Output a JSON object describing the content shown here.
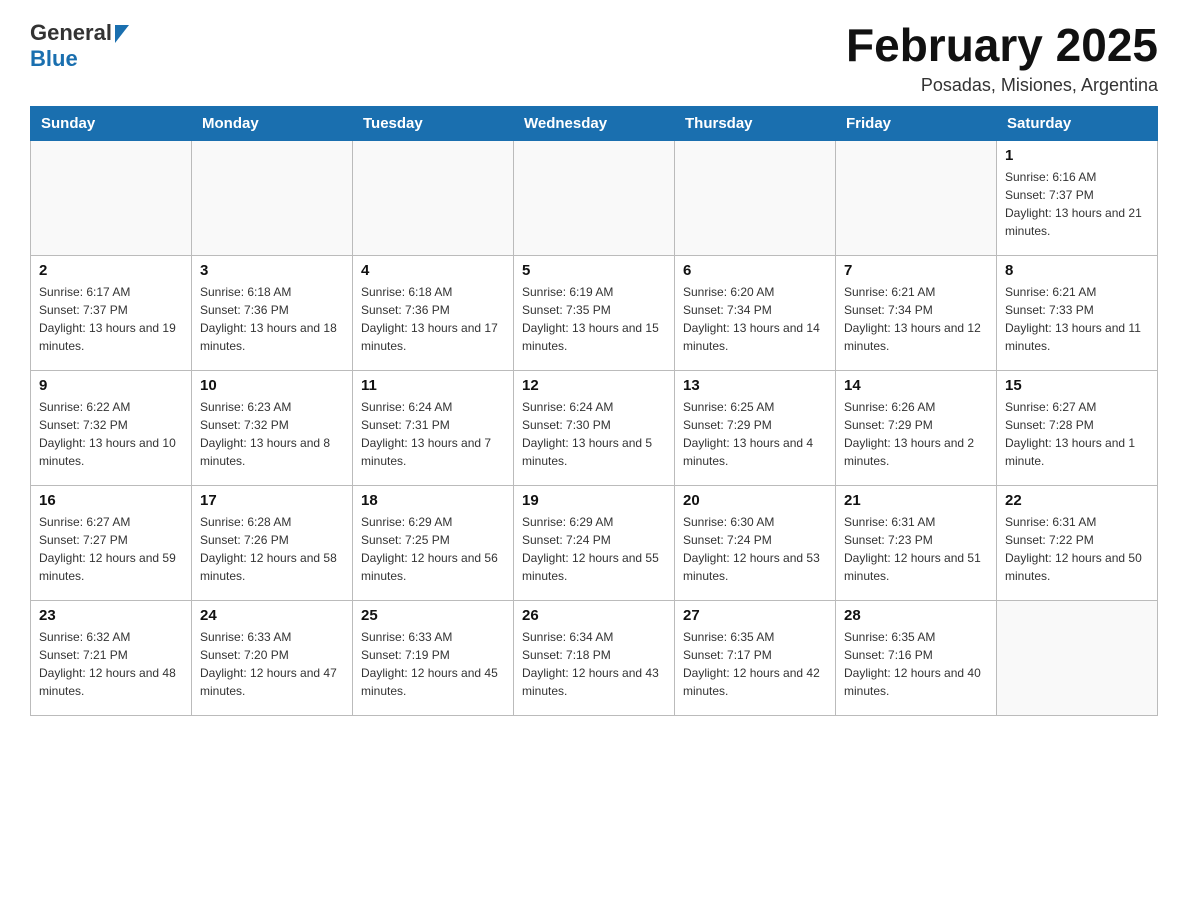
{
  "header": {
    "logo": {
      "general": "General",
      "blue": "Blue"
    },
    "title": "February 2025",
    "subtitle": "Posadas, Misiones, Argentina"
  },
  "calendar": {
    "headers": [
      "Sunday",
      "Monday",
      "Tuesday",
      "Wednesday",
      "Thursday",
      "Friday",
      "Saturday"
    ],
    "rows": [
      [
        {
          "day": "",
          "info": ""
        },
        {
          "day": "",
          "info": ""
        },
        {
          "day": "",
          "info": ""
        },
        {
          "day": "",
          "info": ""
        },
        {
          "day": "",
          "info": ""
        },
        {
          "day": "",
          "info": ""
        },
        {
          "day": "1",
          "info": "Sunrise: 6:16 AM\nSunset: 7:37 PM\nDaylight: 13 hours and 21 minutes."
        }
      ],
      [
        {
          "day": "2",
          "info": "Sunrise: 6:17 AM\nSunset: 7:37 PM\nDaylight: 13 hours and 19 minutes."
        },
        {
          "day": "3",
          "info": "Sunrise: 6:18 AM\nSunset: 7:36 PM\nDaylight: 13 hours and 18 minutes."
        },
        {
          "day": "4",
          "info": "Sunrise: 6:18 AM\nSunset: 7:36 PM\nDaylight: 13 hours and 17 minutes."
        },
        {
          "day": "5",
          "info": "Sunrise: 6:19 AM\nSunset: 7:35 PM\nDaylight: 13 hours and 15 minutes."
        },
        {
          "day": "6",
          "info": "Sunrise: 6:20 AM\nSunset: 7:34 PM\nDaylight: 13 hours and 14 minutes."
        },
        {
          "day": "7",
          "info": "Sunrise: 6:21 AM\nSunset: 7:34 PM\nDaylight: 13 hours and 12 minutes."
        },
        {
          "day": "8",
          "info": "Sunrise: 6:21 AM\nSunset: 7:33 PM\nDaylight: 13 hours and 11 minutes."
        }
      ],
      [
        {
          "day": "9",
          "info": "Sunrise: 6:22 AM\nSunset: 7:32 PM\nDaylight: 13 hours and 10 minutes."
        },
        {
          "day": "10",
          "info": "Sunrise: 6:23 AM\nSunset: 7:32 PM\nDaylight: 13 hours and 8 minutes."
        },
        {
          "day": "11",
          "info": "Sunrise: 6:24 AM\nSunset: 7:31 PM\nDaylight: 13 hours and 7 minutes."
        },
        {
          "day": "12",
          "info": "Sunrise: 6:24 AM\nSunset: 7:30 PM\nDaylight: 13 hours and 5 minutes."
        },
        {
          "day": "13",
          "info": "Sunrise: 6:25 AM\nSunset: 7:29 PM\nDaylight: 13 hours and 4 minutes."
        },
        {
          "day": "14",
          "info": "Sunrise: 6:26 AM\nSunset: 7:29 PM\nDaylight: 13 hours and 2 minutes."
        },
        {
          "day": "15",
          "info": "Sunrise: 6:27 AM\nSunset: 7:28 PM\nDaylight: 13 hours and 1 minute."
        }
      ],
      [
        {
          "day": "16",
          "info": "Sunrise: 6:27 AM\nSunset: 7:27 PM\nDaylight: 12 hours and 59 minutes."
        },
        {
          "day": "17",
          "info": "Sunrise: 6:28 AM\nSunset: 7:26 PM\nDaylight: 12 hours and 58 minutes."
        },
        {
          "day": "18",
          "info": "Sunrise: 6:29 AM\nSunset: 7:25 PM\nDaylight: 12 hours and 56 minutes."
        },
        {
          "day": "19",
          "info": "Sunrise: 6:29 AM\nSunset: 7:24 PM\nDaylight: 12 hours and 55 minutes."
        },
        {
          "day": "20",
          "info": "Sunrise: 6:30 AM\nSunset: 7:24 PM\nDaylight: 12 hours and 53 minutes."
        },
        {
          "day": "21",
          "info": "Sunrise: 6:31 AM\nSunset: 7:23 PM\nDaylight: 12 hours and 51 minutes."
        },
        {
          "day": "22",
          "info": "Sunrise: 6:31 AM\nSunset: 7:22 PM\nDaylight: 12 hours and 50 minutes."
        }
      ],
      [
        {
          "day": "23",
          "info": "Sunrise: 6:32 AM\nSunset: 7:21 PM\nDaylight: 12 hours and 48 minutes."
        },
        {
          "day": "24",
          "info": "Sunrise: 6:33 AM\nSunset: 7:20 PM\nDaylight: 12 hours and 47 minutes."
        },
        {
          "day": "25",
          "info": "Sunrise: 6:33 AM\nSunset: 7:19 PM\nDaylight: 12 hours and 45 minutes."
        },
        {
          "day": "26",
          "info": "Sunrise: 6:34 AM\nSunset: 7:18 PM\nDaylight: 12 hours and 43 minutes."
        },
        {
          "day": "27",
          "info": "Sunrise: 6:35 AM\nSunset: 7:17 PM\nDaylight: 12 hours and 42 minutes."
        },
        {
          "day": "28",
          "info": "Sunrise: 6:35 AM\nSunset: 7:16 PM\nDaylight: 12 hours and 40 minutes."
        },
        {
          "day": "",
          "info": ""
        }
      ]
    ]
  }
}
